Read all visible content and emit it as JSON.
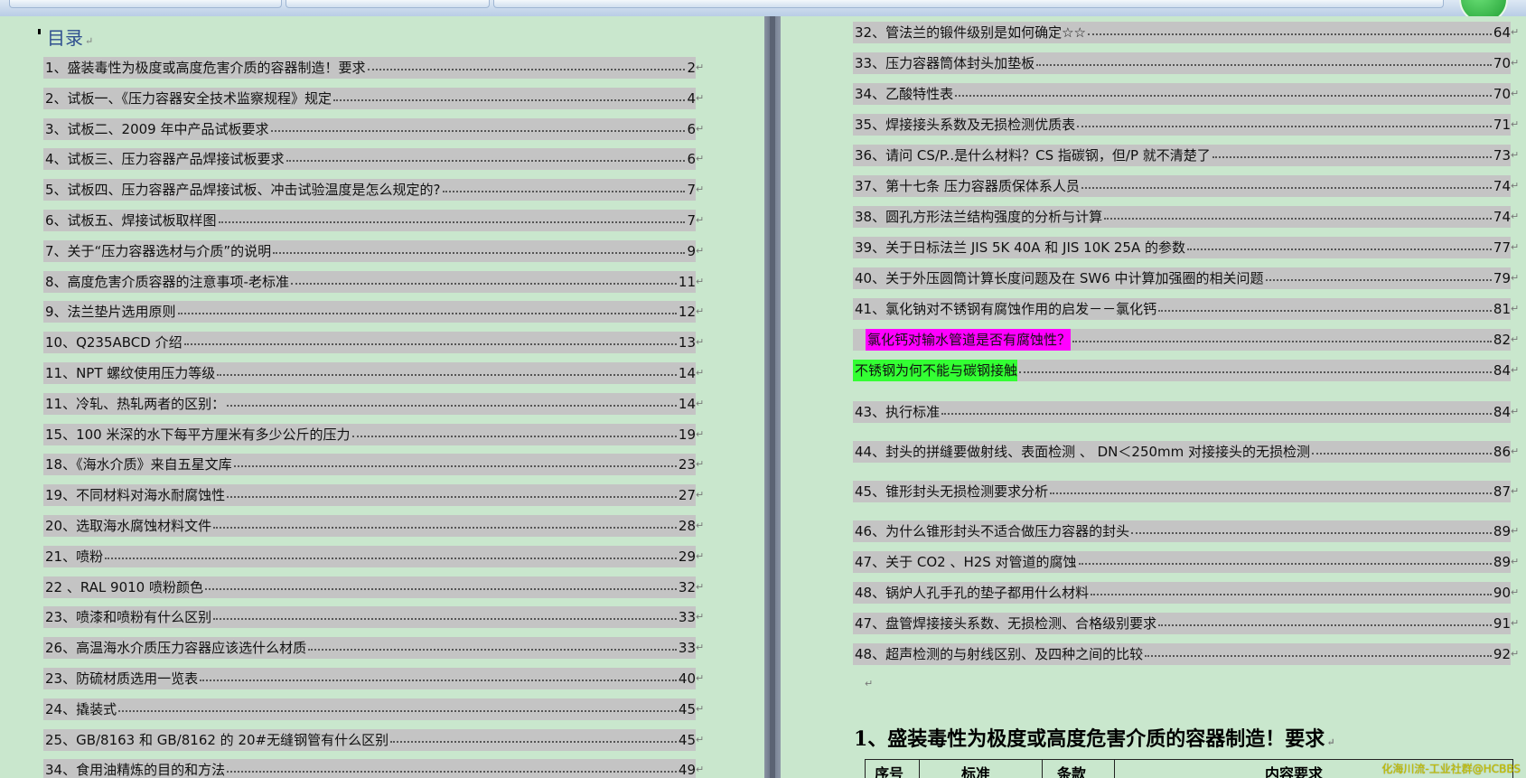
{
  "toc": {
    "title": "目录",
    "left_entries": [
      {
        "text": "1、盛装毒性为极度或高度危害介质的容器制造！要求",
        "page": "2"
      },
      {
        "text": "2、试板一、《压力容器安全技术监察规程》规定",
        "page": "4"
      },
      {
        "text": "3、试板二、2009 年中产品试板要求",
        "page": "6"
      },
      {
        "text": "4、试板三、压力容器产品焊接试板要求",
        "page": "6"
      },
      {
        "text": "5、试板四、压力容器产品焊接试板、冲击试验温度是怎么规定的?",
        "page": "7"
      },
      {
        "text": "6、试板五、焊接试板取样图",
        "page": "7"
      },
      {
        "text": "7、关于“压力容器选材与介质”的说明",
        "page": "9"
      },
      {
        "text": "8、高度危害介质容器的注意事项-老标准",
        "page": "11"
      },
      {
        "text": "9、法兰垫片选用原则",
        "page": "12"
      },
      {
        "text": "10、Q235ABCD 介绍",
        "page": "13"
      },
      {
        "text": "11、NPT 螺纹使用压力等级",
        "page": "14"
      },
      {
        "text": "11、冷轧、热轧两者的区别：",
        "page": "14"
      },
      {
        "text": "15、100 米深的水下每平方厘米有多少公斤的压力",
        "page": "19"
      },
      {
        "text": "18、《海水介质》来自五星文库",
        "page": "23"
      },
      {
        "text": "19、不同材料对海水耐腐蚀性",
        "page": "27"
      },
      {
        "text": "20、选取海水腐蚀材料文件",
        "page": "28"
      },
      {
        "text": "21、喷粉",
        "page": "29"
      },
      {
        "text": "22 、RAL 9010   喷粉颜色",
        "page": "32"
      },
      {
        "text": "23、喷漆和喷粉有什么区别",
        "page": "33"
      },
      {
        "text": "26、高温海水介质压力容器应该选什么材质",
        "page": "33"
      },
      {
        "text": "23、防硫材质选用一览表",
        "page": "40"
      },
      {
        "text": "24、撬装式",
        "page": "45"
      },
      {
        "text": "25、GB/8163 和 GB/8162 的 20#无缝钢管有什么区别",
        "page": "45"
      },
      {
        "text": "34、食用油精炼的目的和方法",
        "page": "49"
      }
    ],
    "right_entries": [
      {
        "text": "32、管法兰的锻件级别是如何确定☆☆",
        "page": "64"
      },
      {
        "text": "33、压力容器筒体封头加垫板",
        "page": "70"
      },
      {
        "text": "34、乙酸特性表",
        "page": "70"
      },
      {
        "text": "35、焊接接头系数及无损检测优质表",
        "page": "71"
      },
      {
        "text": "36、请问 CS/P..是什么材料？CS 指碳钢，但/P 就不清楚了",
        "page": "73"
      },
      {
        "text": "37、第十七条   压力容器质保体系人员",
        "page": "74"
      },
      {
        "text": "38、圆孔方形法兰结构强度的分析与计算",
        "page": "74"
      },
      {
        "text": "39、关于日标法兰 JIS 5K 40A  和  JIS 10K 25A 的参数",
        "page": "77"
      },
      {
        "text": "40、关于外压圆筒计算长度问题及在 SW6 中计算加强圈的相关问题",
        "page": "79"
      },
      {
        "text": "41、氯化钠对不锈钢有腐蚀作用的启发－－氯化钙",
        "page": "81"
      },
      {
        "text": "氯化钙对输水管道是否有腐蚀性？",
        "page": "82"
      },
      {
        "text": "不锈钢为何不能与碳钢接触",
        "page": "84"
      },
      {
        "text": "43、执行标准",
        "page": "84"
      },
      {
        "text": "44、封头的拼缝要做射线、表面检测 、 DN＜250mm 对接接头的无损检测",
        "page": "86"
      },
      {
        "text": "45、锥形封头无损检测要求分析",
        "page": "87"
      },
      {
        "text": "46、为什么锥形封头不适合做压力容器的封头",
        "page": "89"
      },
      {
        "text": "47、关于 CO2 、H2S 对管道的腐蚀",
        "page": "89"
      },
      {
        "text": "48、锅炉人孔手孔的垫子都用什么材料",
        "page": "90"
      },
      {
        "text": "47、盘管焊接接头系数、无损检测、合格级别要求",
        "page": "91"
      },
      {
        "text": "48、超声检测的与射线区别、及四种之间的比较",
        "page": "92"
      }
    ]
  },
  "section": {
    "heading": "1、盛装毒性为极度或高度危害介质的容器制造！要求",
    "table_headers": [
      "序号",
      "标准",
      "条款",
      "内容要求"
    ]
  },
  "watermark": "化海川流-工业社群@HCBBS",
  "colors": {
    "page_bg": "#c9e7cd",
    "field_shading": "#c4c4c4",
    "highlight_magenta": "#ff00ff",
    "highlight_green": "#33ff33",
    "title_blue": "#2f4f8f"
  }
}
